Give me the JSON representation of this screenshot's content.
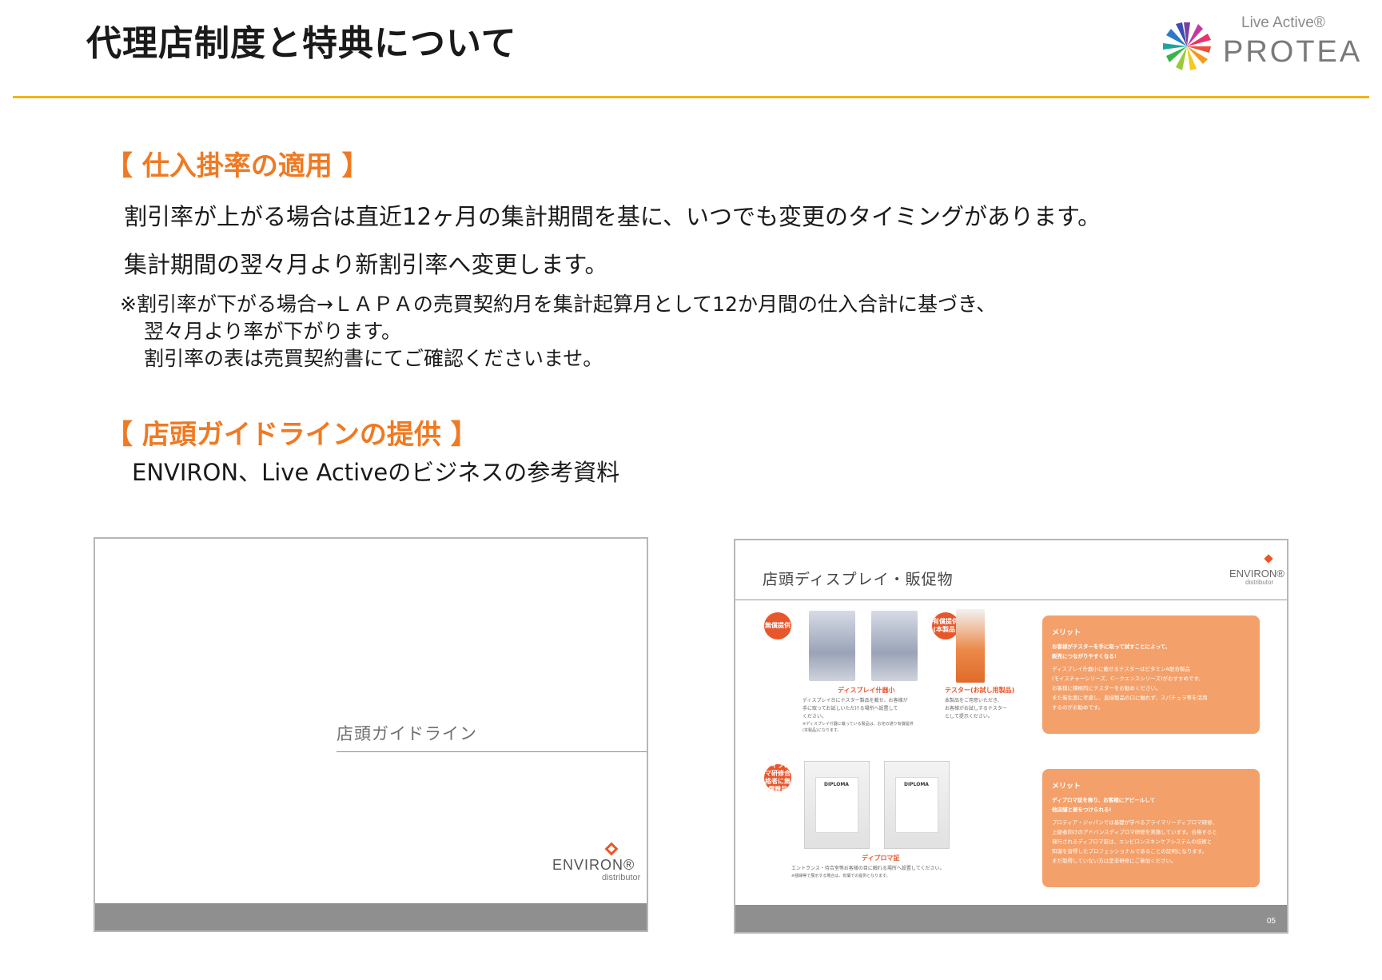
{
  "header": {
    "title": "代理店制度と特典について",
    "logo": {
      "tagline": "Live Active®",
      "wordmark": "PROTEA"
    }
  },
  "section1": {
    "heading": "【 仕入掛率の適用 】",
    "lines": [
      "割引率が上がる場合は直近12ヶ月の集計期間を基に、いつでも変更のタイミングがあります。",
      "集計期間の翌々月より新割引率へ変更します。"
    ],
    "notes": [
      "※割引率が下がる場合→ＬＡＰＡの売買契約月を集計起算月として12か月間の仕入合計に基づき、",
      "翌々月より率が下がります。",
      "割引率の表は売買契約書にてご確認くださいませ。"
    ]
  },
  "section2": {
    "heading": "【 店頭ガイドラインの提供 】",
    "line": "ENVIRON、Live Activeのビジネスの参考資料"
  },
  "slide1": {
    "title": "店頭ガイドライン",
    "brand": "ENVIRON®",
    "brand_sub": "distributor"
  },
  "slide2": {
    "title": "店頭ディスプレイ・販促物",
    "brand": "ENVIRON®",
    "brand_sub": "distributor",
    "page_number": "05",
    "badge1": "無償提供",
    "badge2": "有償提供(本製品)",
    "badge3": "ディプロマ研修合格者に無償贈呈",
    "caption1": "ディスプレイ什器小",
    "caption1_text": [
      "ディスプレイ台にテスター製品を載せ、お客様が",
      "手に取ってお試しいただける場所へ設置して",
      "ください。",
      "※ディスプレイ什器に載っている製品は、お定の通り有償提供",
      "(本製品)になります。"
    ],
    "caption2": "テスター(お試し用製品)",
    "caption2_text": [
      "本製品をご用意いただき、",
      "お客様がお試しするテスター",
      "として提示ください。"
    ],
    "caption3": "ディプロマ証",
    "caption3_text": [
      "エントランス・待合室等お客様の目に触れる場所へ設置してください。",
      "※額縁等で展示する場合は、有償での提供となります。"
    ],
    "diploma_label": "DIPLOMA",
    "merit1": {
      "head": "メリット",
      "lines": [
        "お客様がテスターを手に取って試すことによって、",
        "販売につながりやすくなる!",
        "ディスプレイ什器小に載せるテスターはビタミンA配合製品",
        "(モイスチャーシリーズ、C－クエンスシリーズ)がおすすめです。",
        "お客様に積極的にテスターをお勧めください。",
        "また衛生面に考慮し、直接製品の口に触れず、スパチュラ等を活用",
        "するのがお勧めです。"
      ]
    },
    "merit2": {
      "head": "メリット",
      "lines": [
        "ディプロマ証を飾り、お客様にアピールして",
        "他店舗と差をつけられる!",
        "プロティア・ジャパンでは基礎が学べるプライマリーディプロマ研修、",
        "上級者向けのアドバンスディプロマ研修を実施しています。合格すると",
        "発行されるディプロマ証は、エンビロンスキンケアシステムの技術と",
        "知識を習得したプロフェッショナルであることの証明になります。",
        "まだ取得していない方は是非研修にご参加ください。"
      ]
    }
  },
  "colors": {
    "accent_orange": "#ef7a22",
    "header_rule": "#f2b418",
    "merit_box": "#f4a06a",
    "badge": "#e8572b"
  }
}
